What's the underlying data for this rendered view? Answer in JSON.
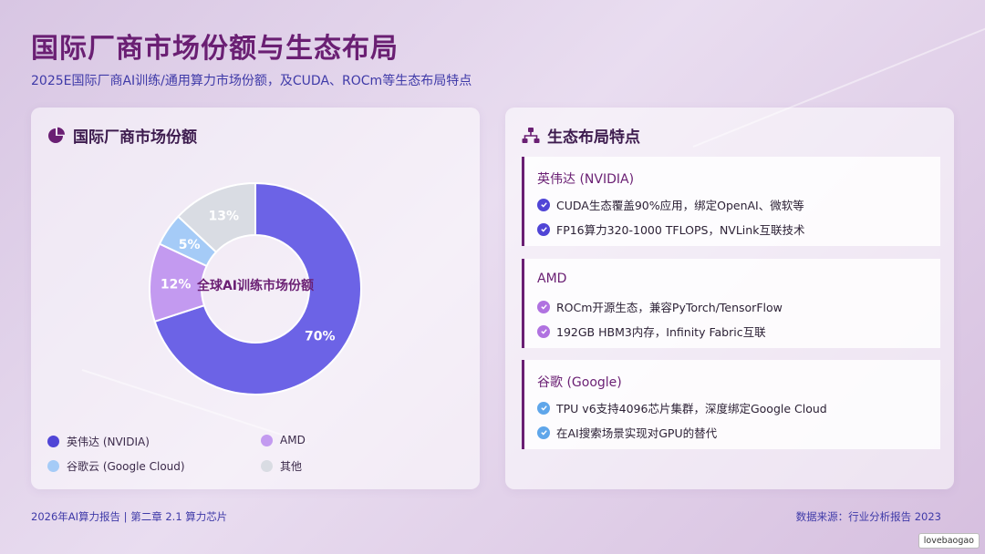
{
  "page": {
    "title": "国际厂商市场份额与生态布局",
    "subtitle": "2025E国际厂商AI训练/通用算力市场份额，及CUDA、ROCm等生态布局特点"
  },
  "left_card": {
    "title": "国际厂商市场份额",
    "icon": "pie-chart-icon"
  },
  "chart_data": {
    "type": "pie",
    "variant": "donut",
    "center_label": "全球AI训练市场份额",
    "categories": [
      "英伟达 (NVIDIA)",
      "AMD",
      "谷歌云 (Google Cloud)",
      "其他"
    ],
    "values": [
      70,
      12,
      5,
      13
    ],
    "value_labels": [
      "70%",
      "12%",
      "5%",
      "13%"
    ],
    "colors": [
      "#6c63e6",
      "#c39af0",
      "#a5cbf7",
      "#d9dce3"
    ],
    "legend_position": "bottom"
  },
  "right_card": {
    "title": "生态布局特点",
    "icon": "sitemap-icon",
    "blocks": [
      {
        "title": "英伟达 (NVIDIA)",
        "check_color": "#5045d6",
        "items": [
          "CUDA生态覆盖90%应用，绑定OpenAI、微软等",
          "FP16算力320-1000 TFLOPS，NVLink互联技术"
        ]
      },
      {
        "title": "AMD",
        "check_color": "#b072e0",
        "items": [
          "ROCm开源生态，兼容PyTorch/TensorFlow",
          "192GB HBM3内存，Infinity Fabric互联"
        ]
      },
      {
        "title": "谷歌 (Google)",
        "check_color": "#5fa6ea",
        "items": [
          "TPU v6支持4096芯片集群，深度绑定Google Cloud",
          "在AI搜索场景实现对GPU的替代"
        ]
      }
    ]
  },
  "footer": {
    "left": "2026年AI算力报告 | 第二章 2.1 算力芯片",
    "right": "数据来源：行业分析报告 2023",
    "watermark": "lovebaogao"
  }
}
